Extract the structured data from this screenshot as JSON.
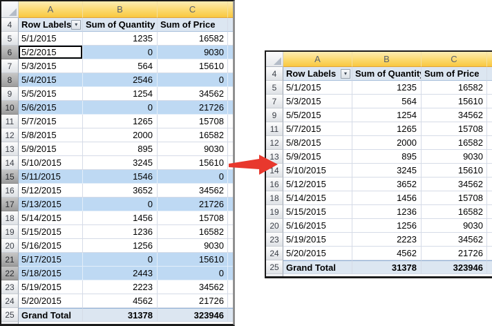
{
  "left_table": {
    "columns": [
      "A",
      "B",
      "C"
    ],
    "header_row": {
      "number": "4",
      "cells": [
        "Row Labels",
        "Sum of Quantity",
        "Sum of Price"
      ],
      "has_filter_dropdown": true
    },
    "rows": [
      {
        "n": "5",
        "date": "5/1/2015",
        "qty": "1235",
        "price": "16582",
        "hl": false,
        "active": false
      },
      {
        "n": "6",
        "date": "5/2/2015",
        "qty": "0",
        "price": "9030",
        "hl": true,
        "active": true
      },
      {
        "n": "7",
        "date": "5/3/2015",
        "qty": "564",
        "price": "15610",
        "hl": false,
        "active": false
      },
      {
        "n": "8",
        "date": "5/4/2015",
        "qty": "2546",
        "price": "0",
        "hl": true,
        "active": false
      },
      {
        "n": "9",
        "date": "5/5/2015",
        "qty": "1254",
        "price": "34562",
        "hl": false,
        "active": false
      },
      {
        "n": "10",
        "date": "5/6/2015",
        "qty": "0",
        "price": "21726",
        "hl": true,
        "active": false
      },
      {
        "n": "11",
        "date": "5/7/2015",
        "qty": "1265",
        "price": "15708",
        "hl": false,
        "active": false
      },
      {
        "n": "12",
        "date": "5/8/2015",
        "qty": "2000",
        "price": "16582",
        "hl": false,
        "active": false
      },
      {
        "n": "13",
        "date": "5/9/2015",
        "qty": "895",
        "price": "9030",
        "hl": false,
        "active": false
      },
      {
        "n": "14",
        "date": "5/10/2015",
        "qty": "3245",
        "price": "15610",
        "hl": false,
        "active": false
      },
      {
        "n": "15",
        "date": "5/11/2015",
        "qty": "1546",
        "price": "0",
        "hl": true,
        "active": false
      },
      {
        "n": "16",
        "date": "5/12/2015",
        "qty": "3652",
        "price": "34562",
        "hl": false,
        "active": false
      },
      {
        "n": "17",
        "date": "5/13/2015",
        "qty": "0",
        "price": "21726",
        "hl": true,
        "active": false
      },
      {
        "n": "18",
        "date": "5/14/2015",
        "qty": "1456",
        "price": "15708",
        "hl": false,
        "active": false
      },
      {
        "n": "19",
        "date": "5/15/2015",
        "qty": "1236",
        "price": "16582",
        "hl": false,
        "active": false
      },
      {
        "n": "20",
        "date": "5/16/2015",
        "qty": "1256",
        "price": "9030",
        "hl": false,
        "active": false
      },
      {
        "n": "21",
        "date": "5/17/2015",
        "qty": "0",
        "price": "15610",
        "hl": true,
        "active": false
      },
      {
        "n": "22",
        "date": "5/18/2015",
        "qty": "2443",
        "price": "0",
        "hl": true,
        "active": false
      },
      {
        "n": "23",
        "date": "5/19/2015",
        "qty": "2223",
        "price": "34562",
        "hl": false,
        "active": false
      },
      {
        "n": "24",
        "date": "5/20/2015",
        "qty": "4562",
        "price": "21726",
        "hl": false,
        "active": false
      }
    ],
    "total_row": {
      "n": "25",
      "label": "Grand Total",
      "qty": "31378",
      "price": "323946"
    }
  },
  "right_table": {
    "columns": [
      "A",
      "B",
      "C"
    ],
    "header_row": {
      "number": "4",
      "cells": [
        "Row Labels",
        "Sum of Quantity",
        "Sum of Price"
      ],
      "has_filter_dropdown": true
    },
    "rows": [
      {
        "n": "5",
        "date": "5/1/2015",
        "qty": "1235",
        "price": "16582",
        "hl": false,
        "active": false
      },
      {
        "n": "7",
        "date": "5/3/2015",
        "qty": "564",
        "price": "15610",
        "hl": false,
        "active": false
      },
      {
        "n": "9",
        "date": "5/5/2015",
        "qty": "1254",
        "price": "34562",
        "hl": false,
        "active": false
      },
      {
        "n": "11",
        "date": "5/7/2015",
        "qty": "1265",
        "price": "15708",
        "hl": false,
        "active": false
      },
      {
        "n": "12",
        "date": "5/8/2015",
        "qty": "2000",
        "price": "16582",
        "hl": false,
        "active": false
      },
      {
        "n": "13",
        "date": "5/9/2015",
        "qty": "895",
        "price": "9030",
        "hl": false,
        "active": false
      },
      {
        "n": "14",
        "date": "5/10/2015",
        "qty": "3245",
        "price": "15610",
        "hl": false,
        "active": false
      },
      {
        "n": "16",
        "date": "5/12/2015",
        "qty": "3652",
        "price": "34562",
        "hl": false,
        "active": false
      },
      {
        "n": "18",
        "date": "5/14/2015",
        "qty": "1456",
        "price": "15708",
        "hl": false,
        "active": false
      },
      {
        "n": "19",
        "date": "5/15/2015",
        "qty": "1236",
        "price": "16582",
        "hl": false,
        "active": false
      },
      {
        "n": "20",
        "date": "5/16/2015",
        "qty": "1256",
        "price": "9030",
        "hl": false,
        "active": false
      },
      {
        "n": "23",
        "date": "5/19/2015",
        "qty": "2223",
        "price": "34562",
        "hl": false,
        "active": false
      },
      {
        "n": "24",
        "date": "5/20/2015",
        "qty": "4562",
        "price": "21726",
        "hl": false,
        "active": false
      }
    ],
    "total_row": {
      "n": "25",
      "label": "Grand Total",
      "qty": "31378",
      "price": "323946"
    }
  },
  "arrow": {
    "color": "#E8382D",
    "direction": "right"
  },
  "icons": {
    "filter_dropdown": "▾"
  },
  "colors": {
    "selected_column_header": "#F9C840",
    "pivot_band_fill": "#DCE6F1",
    "highlight_row_fill": "#BED9F3",
    "selected_row_header": "#ABABAB"
  }
}
